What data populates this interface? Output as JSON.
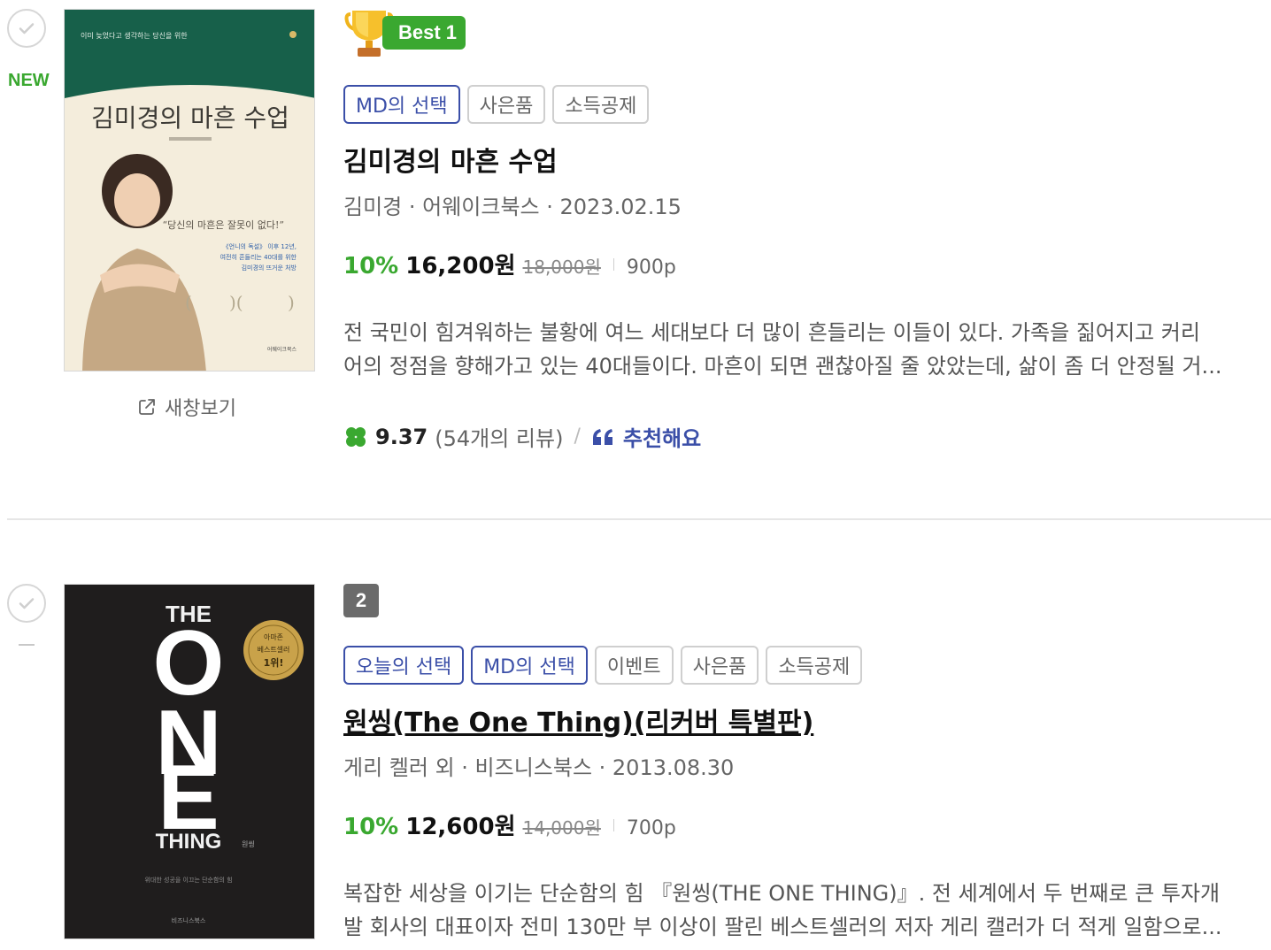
{
  "books": [
    {
      "new_label": "NEW",
      "rank_label": "Best 1",
      "badges": [
        "MD의 선택",
        "사은품",
        "소득공제"
      ],
      "title": "김미경의 마흔 수업",
      "meta": "김미경 · 어웨이크북스 · 2023.02.15",
      "discount_rate": "10%",
      "sale_price": "16,200원",
      "original_price": "18,000원",
      "pages": "900p",
      "desc_line1": "전 국민이 힘겨워하는 불황에 여느 세대보다 더 많이 흔들리는 이들이 있다. 가족을 짊어지고 커리",
      "desc_line2": "어의 정점을 향해가고 있는 40대들이다. 마흔이 되면 괜찮아질 줄 았았는데, 삶이 좀 더 안정될 거...",
      "rating_score": "9.37",
      "review_count": "(54개의 리뷰)",
      "rating_sep": "/",
      "recommend_label": "추천해요",
      "new_window_label": "새창보기",
      "cover": {
        "top_text": "이미 늦었다고 생각하는 당신을 위한",
        "title": "김미경의 마흔 수업",
        "quote": "“당신의 마흔은 잘못이 없다!”",
        "lines": [
          "《언니의 독설》 이후 12년,",
          "여전히 흔들리는 40대를 위한",
          "김미경의 뜨거운 처방"
        ],
        "publisher": "어웨이크북스"
      }
    },
    {
      "rank_label": "2",
      "badges": [
        "오늘의 선택",
        "MD의 선택",
        "이벤트",
        "사은품",
        "소득공제"
      ],
      "title": "원씽(The One Thing)(리커버 특별판)",
      "meta": "게리 켈러 외 · 비즈니스북스 · 2013.08.30",
      "discount_rate": "10%",
      "sale_price": "12,600원",
      "original_price": "14,000원",
      "pages": "700p",
      "desc_line1": "복잡한 세상을 이기는 단순함의 힘 『원씽(THE ONE THING)』. 전 세계에서 두 번째로 큰 투자개",
      "desc_line2": "발 회사의 대표이자 전미 130만 부 이상이 팔린 베스트셀러의 저자 게리 캘러가 더 적게 일함으로...",
      "cover": {
        "the": "THE",
        "o": "O",
        "n": "N",
        "e": "E",
        "thing": "THING",
        "edition": "원씽",
        "seal": [
          "아마존",
          "베스트셀러",
          "1위!"
        ],
        "bottom": "위대한 성공을 이끄는 단순함의 힘",
        "publisher": "비즈니스북스"
      }
    }
  ],
  "colors": {
    "accent_green": "#3aa830",
    "accent_blue": "#3b4fa8",
    "gold": "#e8a317"
  }
}
